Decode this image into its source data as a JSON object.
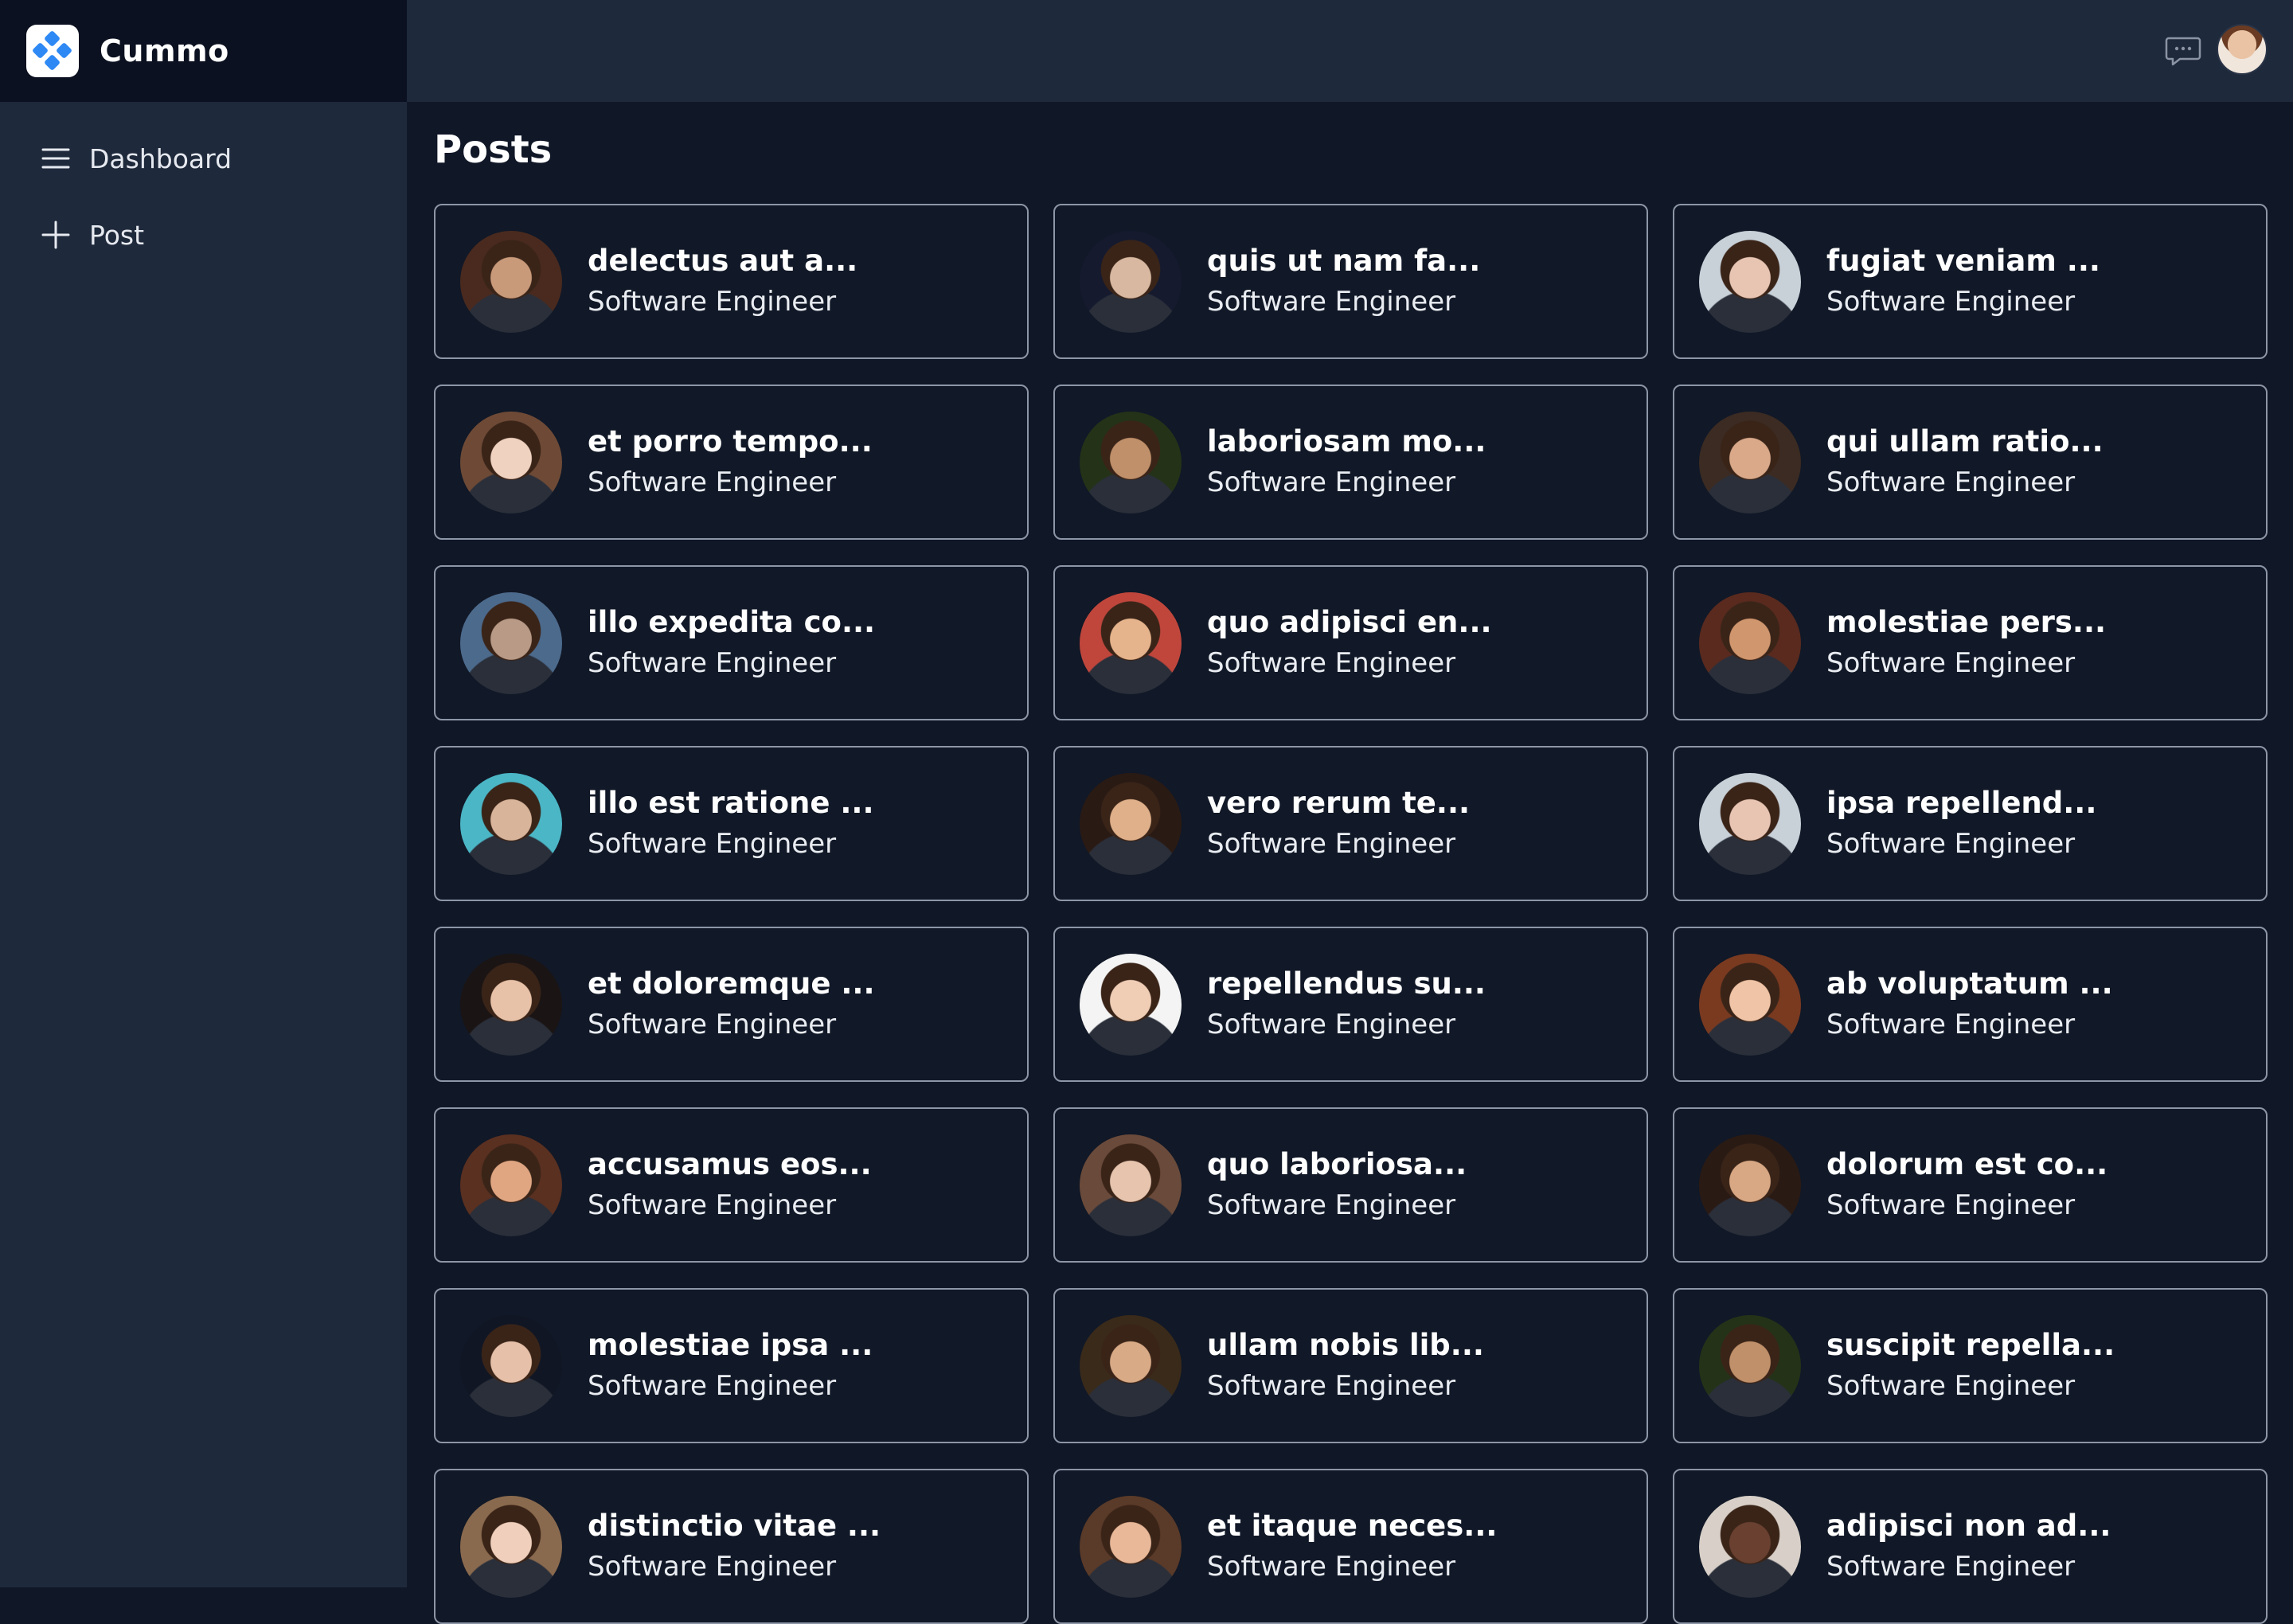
{
  "app": {
    "name": "Cummo"
  },
  "sidebar": {
    "items": [
      {
        "label": "Dashboard",
        "icon": "menu-icon"
      },
      {
        "label": "Post",
        "icon": "plus-icon"
      }
    ]
  },
  "header": {
    "chat_icon": "chat-icon",
    "avatar": "user-avatar"
  },
  "main": {
    "title": "Posts",
    "posts": [
      {
        "title": "delectus aut a...",
        "subtitle": "Software Engineer"
      },
      {
        "title": "quis ut nam fa...",
        "subtitle": "Software Engineer"
      },
      {
        "title": "fugiat veniam ...",
        "subtitle": "Software Engineer"
      },
      {
        "title": "et porro tempo...",
        "subtitle": "Software Engineer"
      },
      {
        "title": "laboriosam mo...",
        "subtitle": "Software Engineer"
      },
      {
        "title": "qui ullam ratio...",
        "subtitle": "Software Engineer"
      },
      {
        "title": "illo expedita co...",
        "subtitle": "Software Engineer"
      },
      {
        "title": "quo adipisci en...",
        "subtitle": "Software Engineer"
      },
      {
        "title": "molestiae pers...",
        "subtitle": "Software Engineer"
      },
      {
        "title": "illo est ratione ...",
        "subtitle": "Software Engineer"
      },
      {
        "title": "vero rerum te...",
        "subtitle": "Software Engineer"
      },
      {
        "title": "ipsa repellend...",
        "subtitle": "Software Engineer"
      },
      {
        "title": "et doloremque ...",
        "subtitle": "Software Engineer"
      },
      {
        "title": "repellendus su...",
        "subtitle": "Software Engineer"
      },
      {
        "title": "ab voluptatum ...",
        "subtitle": "Software Engineer"
      },
      {
        "title": "accusamus eos...",
        "subtitle": "Software Engineer"
      },
      {
        "title": "quo laboriosa...",
        "subtitle": "Software Engineer"
      },
      {
        "title": "dolorum est co...",
        "subtitle": "Software Engineer"
      },
      {
        "title": "molestiae ipsa ...",
        "subtitle": "Software Engineer"
      },
      {
        "title": "ullam nobis lib...",
        "subtitle": "Software Engineer"
      },
      {
        "title": "suscipit repella...",
        "subtitle": "Software Engineer"
      },
      {
        "title": "distinctio vitae ...",
        "subtitle": "Software Engineer"
      },
      {
        "title": "et itaque neces...",
        "subtitle": "Software Engineer"
      },
      {
        "title": "adipisci non ad...",
        "subtitle": "Software Engineer"
      }
    ]
  }
}
